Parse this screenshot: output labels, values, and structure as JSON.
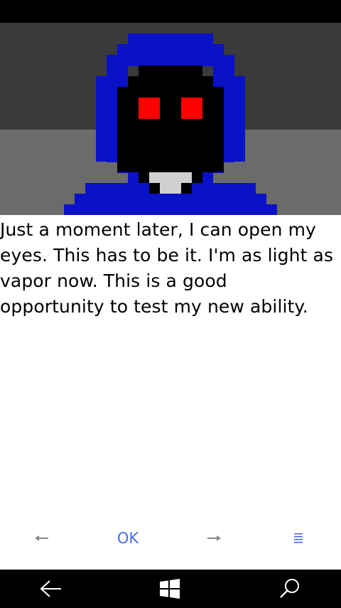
{
  "scene": {
    "colors": {
      "wall": "#3a3a3a",
      "floor": "#6b6b6b",
      "hood": "#0a12c8",
      "face": "#000000",
      "eyes": "#ff0000",
      "collar": "#d0d0d0"
    }
  },
  "story": {
    "text": "Just a moment later, I can open my eyes. This has to be it. I'm as light as vapor now. This is a good opportunity to test my new ability."
  },
  "controls": {
    "ok_label": "OK",
    "prev_icon": "left-arrow-icon",
    "next_icon": "right-arrow-icon",
    "menu_icon": "menu-icon",
    "accent_color": "#4a6be8",
    "muted_color": "#8a8a8a"
  },
  "navbar": {
    "back_icon": "back-arrow-icon",
    "home_icon": "windows-logo-icon",
    "search_icon": "search-icon"
  }
}
